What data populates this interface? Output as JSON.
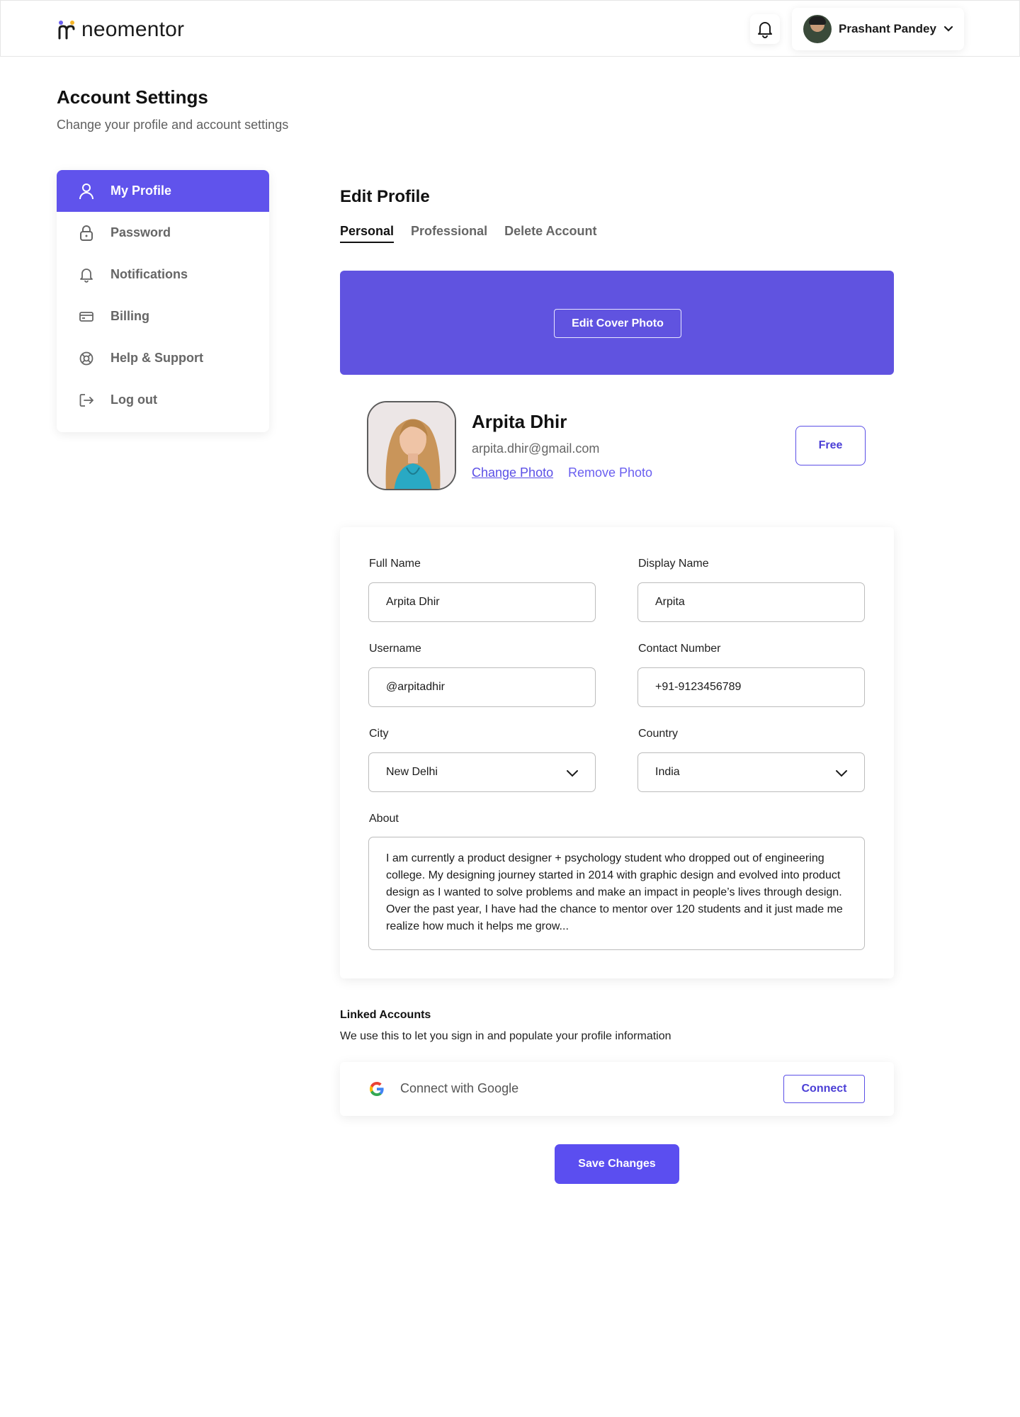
{
  "header": {
    "brand": "neomentor",
    "user_name": "Prashant Pandey"
  },
  "page": {
    "title": "Account Settings",
    "subtitle": "Change your profile and account settings"
  },
  "sidebar": {
    "items": [
      {
        "label": "My Profile",
        "icon": "user-icon",
        "active": true
      },
      {
        "label": "Password",
        "icon": "lock-icon",
        "active": false
      },
      {
        "label": "Notifications",
        "icon": "bell-icon",
        "active": false
      },
      {
        "label": "Billing",
        "icon": "credit-card-icon",
        "active": false
      },
      {
        "label": "Help & Support",
        "icon": "lifebuoy-icon",
        "active": false
      },
      {
        "label": "Log out",
        "icon": "logout-icon",
        "active": false
      }
    ]
  },
  "main": {
    "title": "Edit Profile",
    "tabs": [
      {
        "label": "Personal",
        "active": true
      },
      {
        "label": "Professional",
        "active": false
      },
      {
        "label": "Delete Account",
        "active": false
      }
    ],
    "cover_button": "Edit Cover Photo",
    "accent_color": "#6053e0"
  },
  "profile": {
    "name": "Arpita Dhir",
    "email": "arpita.dhir@gmail.com",
    "change_photo": "Change Photo",
    "remove_photo": "Remove Photo",
    "plan": "Free"
  },
  "form": {
    "full_name": {
      "label": "Full Name",
      "value": "Arpita Dhir"
    },
    "display_name": {
      "label": "Display Name",
      "value": "Arpita"
    },
    "username": {
      "label": "Username",
      "value": "@arpitadhir"
    },
    "contact": {
      "label": "Contact Number",
      "value": "+91-9123456789"
    },
    "city": {
      "label": "City",
      "value": "New Delhi"
    },
    "country": {
      "label": "Country",
      "value": "India"
    },
    "about": {
      "label": "About",
      "value": "I am currently a product designer + psychology student who dropped out of engineering college. My designing journey started in 2014 with graphic design and evolved into product design as I wanted to solve problems and make an impact in people’s lives through design. Over the past year, I have had the chance to mentor over 120 students and it just made me realize how much it helps me grow..."
    }
  },
  "linked": {
    "title": "Linked Accounts",
    "subtitle": "We use this to let you sign in and populate your profile information",
    "google_label": "Connect with Google",
    "connect_button": "Connect"
  },
  "actions": {
    "save": "Save Changes"
  }
}
